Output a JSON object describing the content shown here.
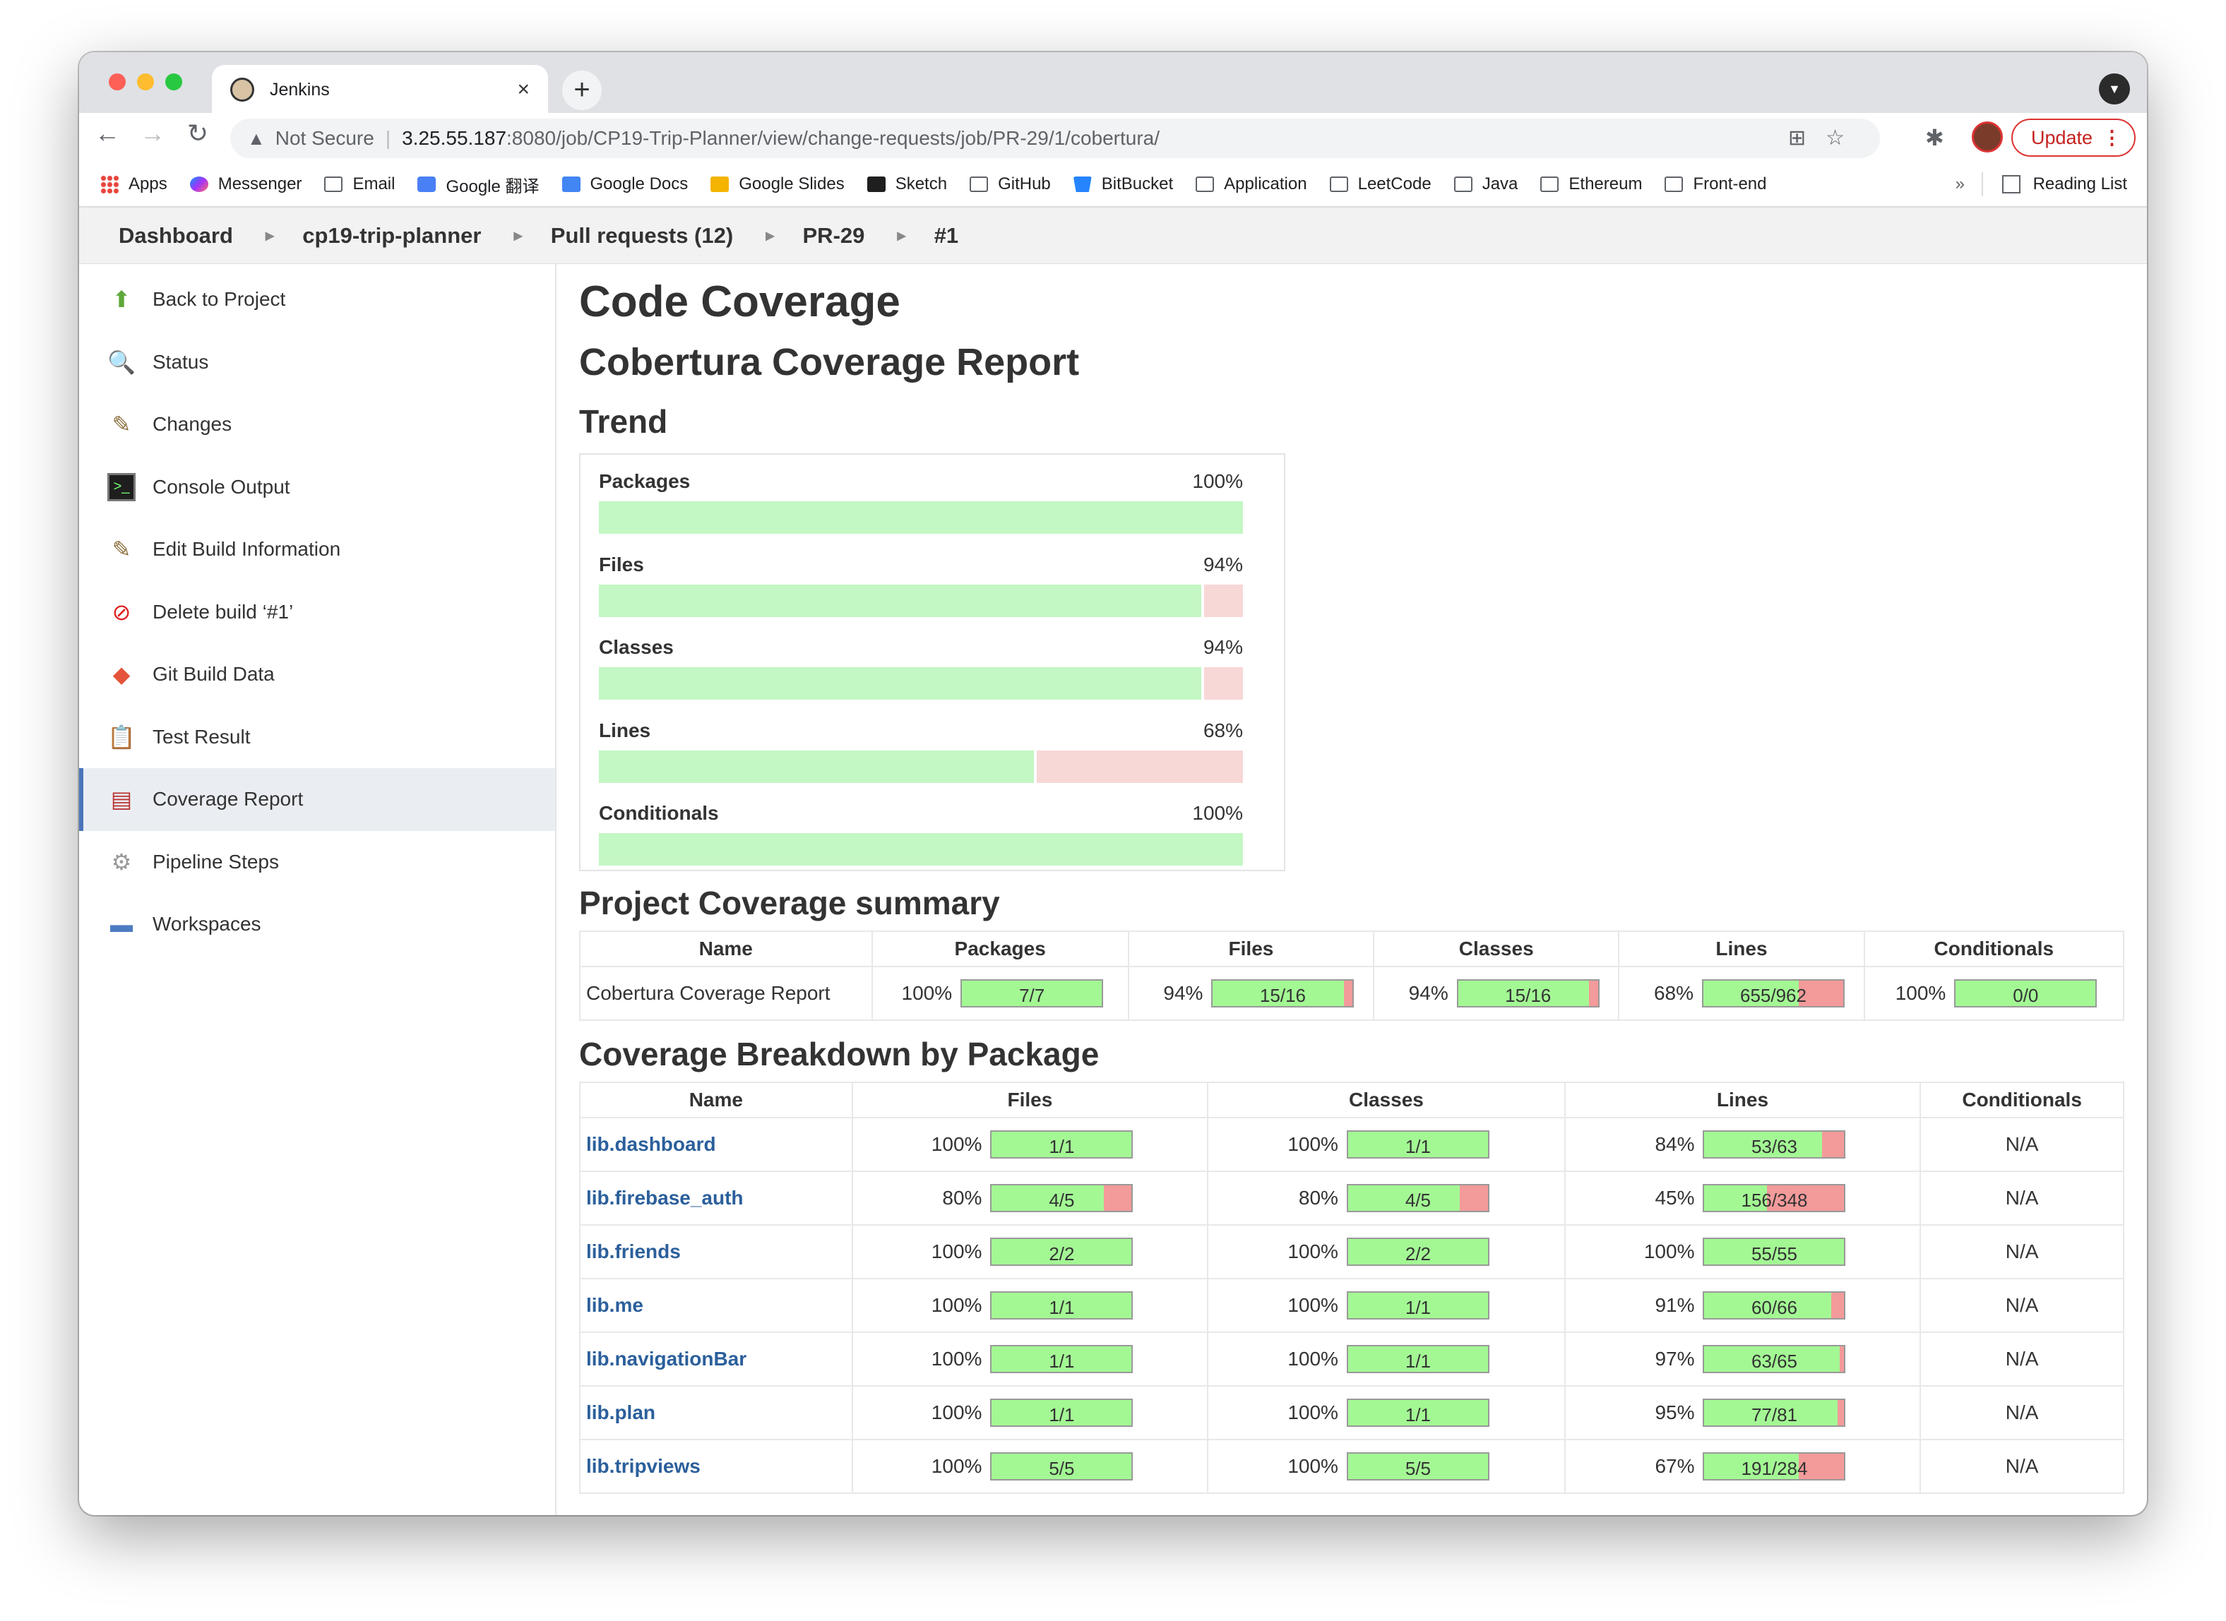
{
  "browser": {
    "tab_title": "Jenkins",
    "tab_close": "×",
    "new_tab": "+",
    "url_warning": "Not Secure",
    "url_host": "3.25.55.187",
    "url_path": ":8080/job/CP19-Trip-Planner/view/change-requests/job/PR-29/1/cobertura/",
    "update_label": "Update",
    "bookmarks": [
      {
        "label": "Apps",
        "icon": "apps-icon"
      },
      {
        "label": "Messenger",
        "icon": "messenger-icon"
      },
      {
        "label": "Email",
        "icon": "folder-icon"
      },
      {
        "label": "Google 翻译",
        "icon": "google-translate-icon"
      },
      {
        "label": "Google Docs",
        "icon": "google-docs-icon"
      },
      {
        "label": "Google Slides",
        "icon": "google-slides-icon"
      },
      {
        "label": "Sketch",
        "icon": "sketch-icon"
      },
      {
        "label": "GitHub",
        "icon": "folder-icon"
      },
      {
        "label": "BitBucket",
        "icon": "bitbucket-icon"
      },
      {
        "label": "Application",
        "icon": "folder-icon"
      },
      {
        "label": "LeetCode",
        "icon": "folder-icon"
      },
      {
        "label": "Java",
        "icon": "folder-icon"
      },
      {
        "label": "Ethereum",
        "icon": "folder-icon"
      },
      {
        "label": "Front-end",
        "icon": "folder-icon"
      }
    ],
    "bookmarks_more": "»",
    "reading_list": "Reading List"
  },
  "breadcrumb": [
    "Dashboard",
    "cp19-trip-planner",
    "Pull requests (12)",
    "PR-29",
    "#1"
  ],
  "sidebar": [
    {
      "label": "Back to Project",
      "icon": "up-arrow-icon"
    },
    {
      "label": "Status",
      "icon": "magnifier-icon"
    },
    {
      "label": "Changes",
      "icon": "notepad-icon"
    },
    {
      "label": "Console Output",
      "icon": "terminal-icon"
    },
    {
      "label": "Edit Build Information",
      "icon": "notepad-icon"
    },
    {
      "label": "Delete build ‘#1’",
      "icon": "no-entry-icon"
    },
    {
      "label": "Git Build Data",
      "icon": "git-icon"
    },
    {
      "label": "Test Result",
      "icon": "clipboard-icon"
    },
    {
      "label": "Coverage Report",
      "icon": "coverage-icon",
      "active": true
    },
    {
      "label": "Pipeline Steps",
      "icon": "gear-icon"
    },
    {
      "label": "Workspaces",
      "icon": "folder-icon"
    }
  ],
  "main": {
    "title": "Code Coverage",
    "subtitle": "Cobertura Coverage Report",
    "trend_heading": "Trend",
    "summary_heading": "Project Coverage summary",
    "breakdown_heading": "Coverage Breakdown by Package"
  },
  "trend": [
    {
      "label": "Packages",
      "pct": "100%",
      "value": 1.0
    },
    {
      "label": "Files",
      "pct": "94%",
      "value": 0.94
    },
    {
      "label": "Classes",
      "pct": "94%",
      "value": 0.94
    },
    {
      "label": "Lines",
      "pct": "68%",
      "value": 0.68
    },
    {
      "label": "Conditionals",
      "pct": "100%",
      "value": 1.0
    }
  ],
  "summary": {
    "headers": [
      "Name",
      "Packages",
      "Files",
      "Classes",
      "Lines",
      "Conditionals"
    ],
    "row": {
      "name": "Cobertura Coverage Report",
      "cells": [
        {
          "pct": "100%",
          "ratio": "7/7",
          "value": 1.0
        },
        {
          "pct": "94%",
          "ratio": "15/16",
          "value": 0.9375
        },
        {
          "pct": "94%",
          "ratio": "15/16",
          "value": 0.9375
        },
        {
          "pct": "68%",
          "ratio": "655/962",
          "value": 0.681
        },
        {
          "pct": "100%",
          "ratio": "0/0",
          "value": 1.0
        }
      ]
    }
  },
  "breakdown": {
    "headers": [
      "Name",
      "Files",
      "Classes",
      "Lines",
      "Conditionals"
    ],
    "rows": [
      {
        "name": "lib.dashboard",
        "files": {
          "pct": "100%",
          "ratio": "1/1",
          "value": 1.0
        },
        "classes": {
          "pct": "100%",
          "ratio": "1/1",
          "value": 1.0
        },
        "lines": {
          "pct": "84%",
          "ratio": "53/63",
          "value": 0.841
        },
        "conditionals": "N/A"
      },
      {
        "name": "lib.firebase_auth",
        "files": {
          "pct": "80%",
          "ratio": "4/5",
          "value": 0.8
        },
        "classes": {
          "pct": "80%",
          "ratio": "4/5",
          "value": 0.8
        },
        "lines": {
          "pct": "45%",
          "ratio": "156/348",
          "value": 0.448
        },
        "conditionals": "N/A"
      },
      {
        "name": "lib.friends",
        "files": {
          "pct": "100%",
          "ratio": "2/2",
          "value": 1.0
        },
        "classes": {
          "pct": "100%",
          "ratio": "2/2",
          "value": 1.0
        },
        "lines": {
          "pct": "100%",
          "ratio": "55/55",
          "value": 1.0
        },
        "conditionals": "N/A"
      },
      {
        "name": "lib.me",
        "files": {
          "pct": "100%",
          "ratio": "1/1",
          "value": 1.0
        },
        "classes": {
          "pct": "100%",
          "ratio": "1/1",
          "value": 1.0
        },
        "lines": {
          "pct": "91%",
          "ratio": "60/66",
          "value": 0.909
        },
        "conditionals": "N/A"
      },
      {
        "name": "lib.navigationBar",
        "files": {
          "pct": "100%",
          "ratio": "1/1",
          "value": 1.0
        },
        "classes": {
          "pct": "100%",
          "ratio": "1/1",
          "value": 1.0
        },
        "lines": {
          "pct": "97%",
          "ratio": "63/65",
          "value": 0.969
        },
        "conditionals": "N/A"
      },
      {
        "name": "lib.plan",
        "files": {
          "pct": "100%",
          "ratio": "1/1",
          "value": 1.0
        },
        "classes": {
          "pct": "100%",
          "ratio": "1/1",
          "value": 1.0
        },
        "lines": {
          "pct": "95%",
          "ratio": "77/81",
          "value": 0.951
        },
        "conditionals": "N/A"
      },
      {
        "name": "lib.tripviews",
        "files": {
          "pct": "100%",
          "ratio": "5/5",
          "value": 1.0
        },
        "classes": {
          "pct": "100%",
          "ratio": "5/5",
          "value": 1.0
        },
        "lines": {
          "pct": "67%",
          "ratio": "191/284",
          "value": 0.673
        },
        "conditionals": "N/A"
      }
    ]
  },
  "colors": {
    "covered": "#a3f894",
    "uncovered": "#f39a9a",
    "trend_covered": "#c3f7c3",
    "trend_uncovered": "#f8d7d7",
    "link": "#2b5f9b",
    "active_accent": "#4b75b9"
  }
}
